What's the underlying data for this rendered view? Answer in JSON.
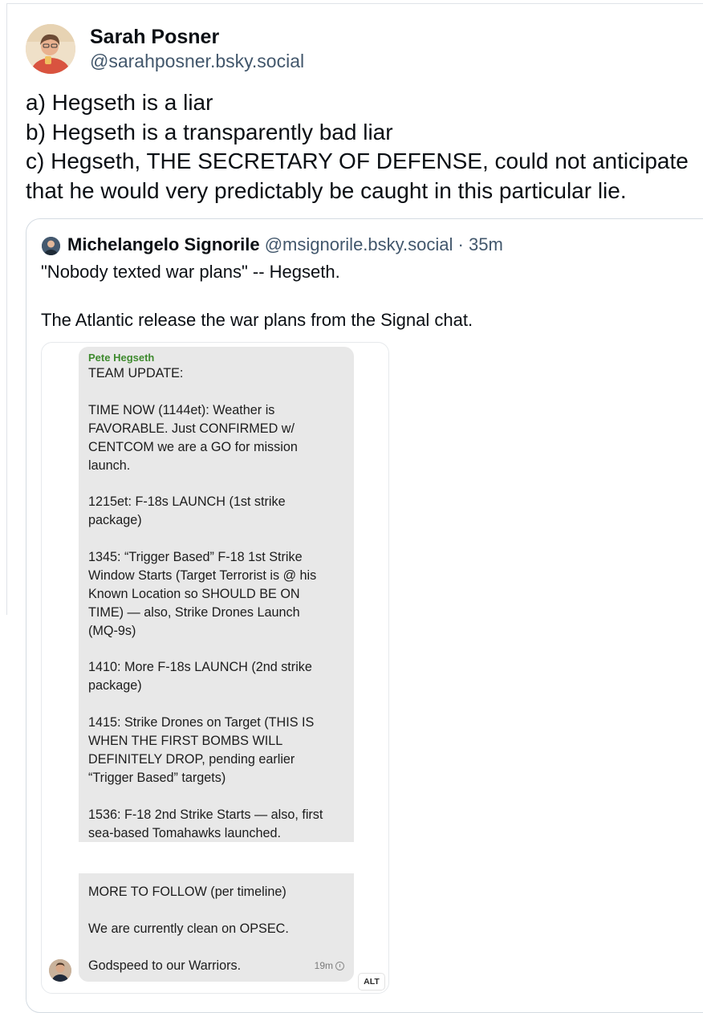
{
  "post": {
    "author_name": "Sarah Posner",
    "author_handle": "@sarahposner.bsky.social",
    "avatar_icon": "user-avatar-icon",
    "text_lines": [
      "a) Hegseth is a liar",
      "b) Hegseth is a transparently bad liar",
      "c) Hegseth, THE SECRETARY OF DEFENSE, could not anticipate",
      "that he would very predictably be caught in this particular lie."
    ]
  },
  "quoted_post": {
    "author_name": "Michelangelo Signorile",
    "author_handle": "@msignorile.bsky.social",
    "separator": "·",
    "time_ago": "35m",
    "text_lines": [
      "\"Nobody texted war plans\" -- Hegseth.",
      "",
      "The Atlantic release the war plans from the Signal chat."
    ]
  },
  "embedded_image": {
    "alt_badge": "ALT",
    "message_1": {
      "sender": "Pete Hegseth",
      "lines": [
        "TEAM UPDATE:",
        "",
        "TIME NOW (1144et): Weather is",
        "FAVORABLE. Just CONFIRMED w/",
        "CENTCOM we are a GO for mission",
        "launch.",
        "",
        "1215et: F-18s LAUNCH (1st strike",
        "package)",
        "",
        "1345: “Trigger Based” F-18 1st Strike",
        "Window Starts (Target Terrorist is @ his",
        "Known Location so SHOULD BE ON",
        "TIME) — also, Strike Drones Launch",
        "(MQ-9s)",
        "",
        "1410: More F-18s LAUNCH (2nd strike",
        "package)",
        "",
        "1415: Strike Drones on Target (THIS IS",
        "WHEN THE FIRST BOMBS WILL",
        "DEFINITELY DROP, pending earlier",
        "“Trigger Based” targets)",
        "",
        "1536: F-18 2nd Strike Starts — also, first",
        "sea-based Tomahawks launched."
      ]
    },
    "message_2": {
      "lines": [
        "MORE TO FOLLOW (per timeline)",
        "",
        "We are currently clean on OPSEC.",
        "",
        "Godspeed to our Warriors."
      ],
      "timestamp": "19m"
    }
  }
}
